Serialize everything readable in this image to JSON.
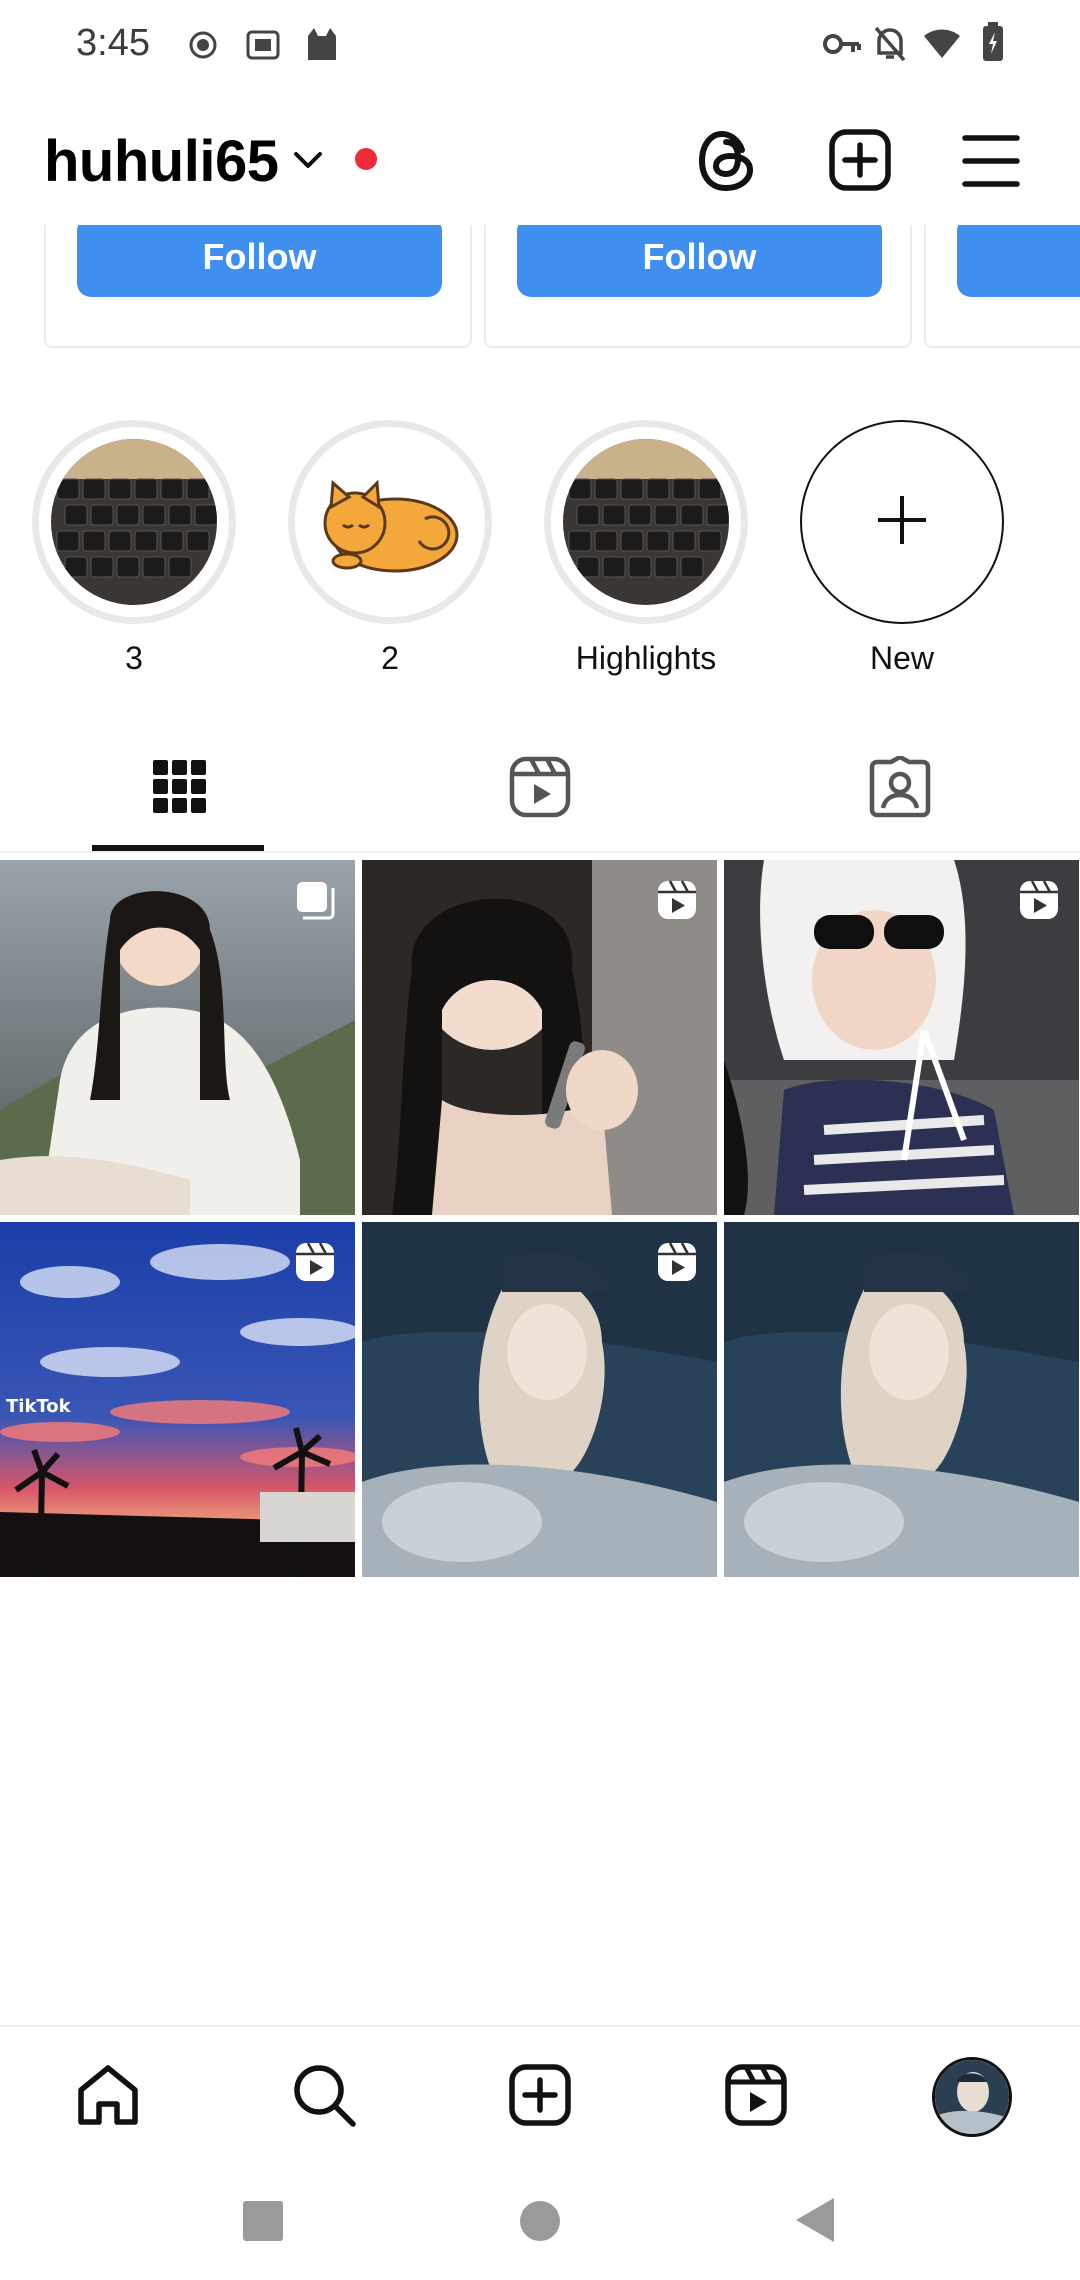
{
  "status_bar": {
    "time": "3:45",
    "left_icons": [
      "record-icon",
      "iqiyi-icon",
      "cat-app-icon"
    ],
    "right_icons": [
      "key-icon",
      "bell-off-icon",
      "wifi-icon",
      "battery-charging-icon"
    ]
  },
  "header": {
    "username": "huhuli65",
    "icons": [
      "threads-icon",
      "create-post-icon",
      "menu-icon"
    ],
    "notification_dot_color": "#ef2b3a"
  },
  "suggestions": {
    "follow_label": "Follow",
    "button_color": "#3f8ff0"
  },
  "highlights": [
    {
      "label": "3",
      "thumb": "keyboard-thumbnail"
    },
    {
      "label": "2",
      "thumb": "orange-cat-thumbnail"
    },
    {
      "label": "Highlights",
      "thumb": "keyboard-thumbnail"
    },
    {
      "label": "New",
      "thumb": "plus-icon"
    }
  ],
  "tabs": [
    {
      "name": "grid",
      "icon": "grid-icon",
      "active": true
    },
    {
      "name": "reels",
      "icon": "reels-icon",
      "active": false
    },
    {
      "name": "tagged",
      "icon": "tagged-person-icon",
      "active": false
    }
  ],
  "posts": [
    {
      "type": "carousel",
      "thumb": "woman-white-jacket-mountains"
    },
    {
      "type": "reel",
      "thumb": "woman-winking-makeup-brush"
    },
    {
      "type": "reel",
      "thumb": "woman-sunglasses-bonnet"
    },
    {
      "type": "reel",
      "thumb": "sunset-sky-palm-trees"
    },
    {
      "type": "reel",
      "thumb": "woman-in-car-cap"
    },
    {
      "type": "plain",
      "thumb": "woman-in-car-cap"
    }
  ],
  "bottom_nav": [
    {
      "name": "home",
      "icon": "home-icon"
    },
    {
      "name": "search",
      "icon": "search-icon"
    },
    {
      "name": "create",
      "icon": "create-icon"
    },
    {
      "name": "reels",
      "icon": "reels-icon"
    },
    {
      "name": "profile",
      "icon": "profile-avatar"
    }
  ],
  "system_nav": [
    "recents-button",
    "home-button",
    "back-button"
  ]
}
